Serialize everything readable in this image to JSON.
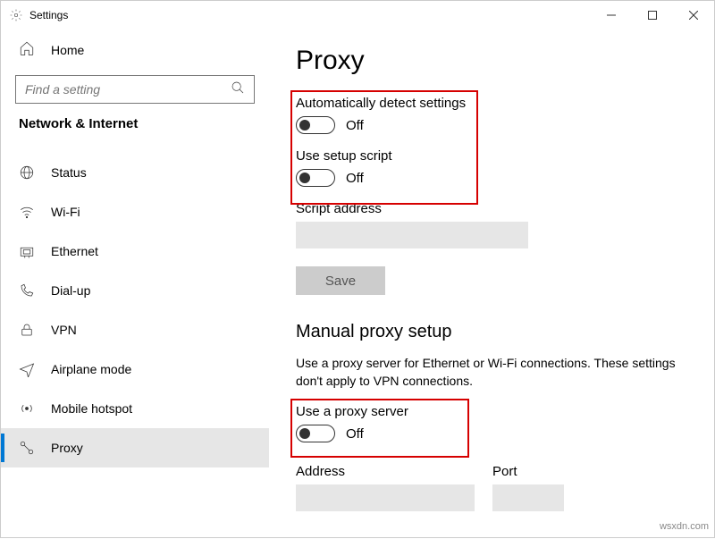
{
  "window": {
    "title": "Settings"
  },
  "sidebar": {
    "home": "Home",
    "search_placeholder": "Find a setting",
    "category": "Network & Internet",
    "items": [
      {
        "label": "Status"
      },
      {
        "label": "Wi-Fi"
      },
      {
        "label": "Ethernet"
      },
      {
        "label": "Dial-up"
      },
      {
        "label": "VPN"
      },
      {
        "label": "Airplane mode"
      },
      {
        "label": "Mobile hotspot"
      },
      {
        "label": "Proxy"
      }
    ]
  },
  "main": {
    "title": "Proxy",
    "auto_detect": {
      "label": "Automatically detect settings",
      "state": "Off"
    },
    "setup_script": {
      "label": "Use setup script",
      "state": "Off"
    },
    "script_address": {
      "label": "Script address",
      "value": ""
    },
    "save_label": "Save",
    "manual_heading": "Manual proxy setup",
    "manual_desc": "Use a proxy server for Ethernet or Wi-Fi connections. These settings don't apply to VPN connections.",
    "use_proxy": {
      "label": "Use a proxy server",
      "state": "Off"
    },
    "address": {
      "label": "Address",
      "value": ""
    },
    "port": {
      "label": "Port",
      "value": ""
    }
  },
  "watermark": "wsxdn.com"
}
